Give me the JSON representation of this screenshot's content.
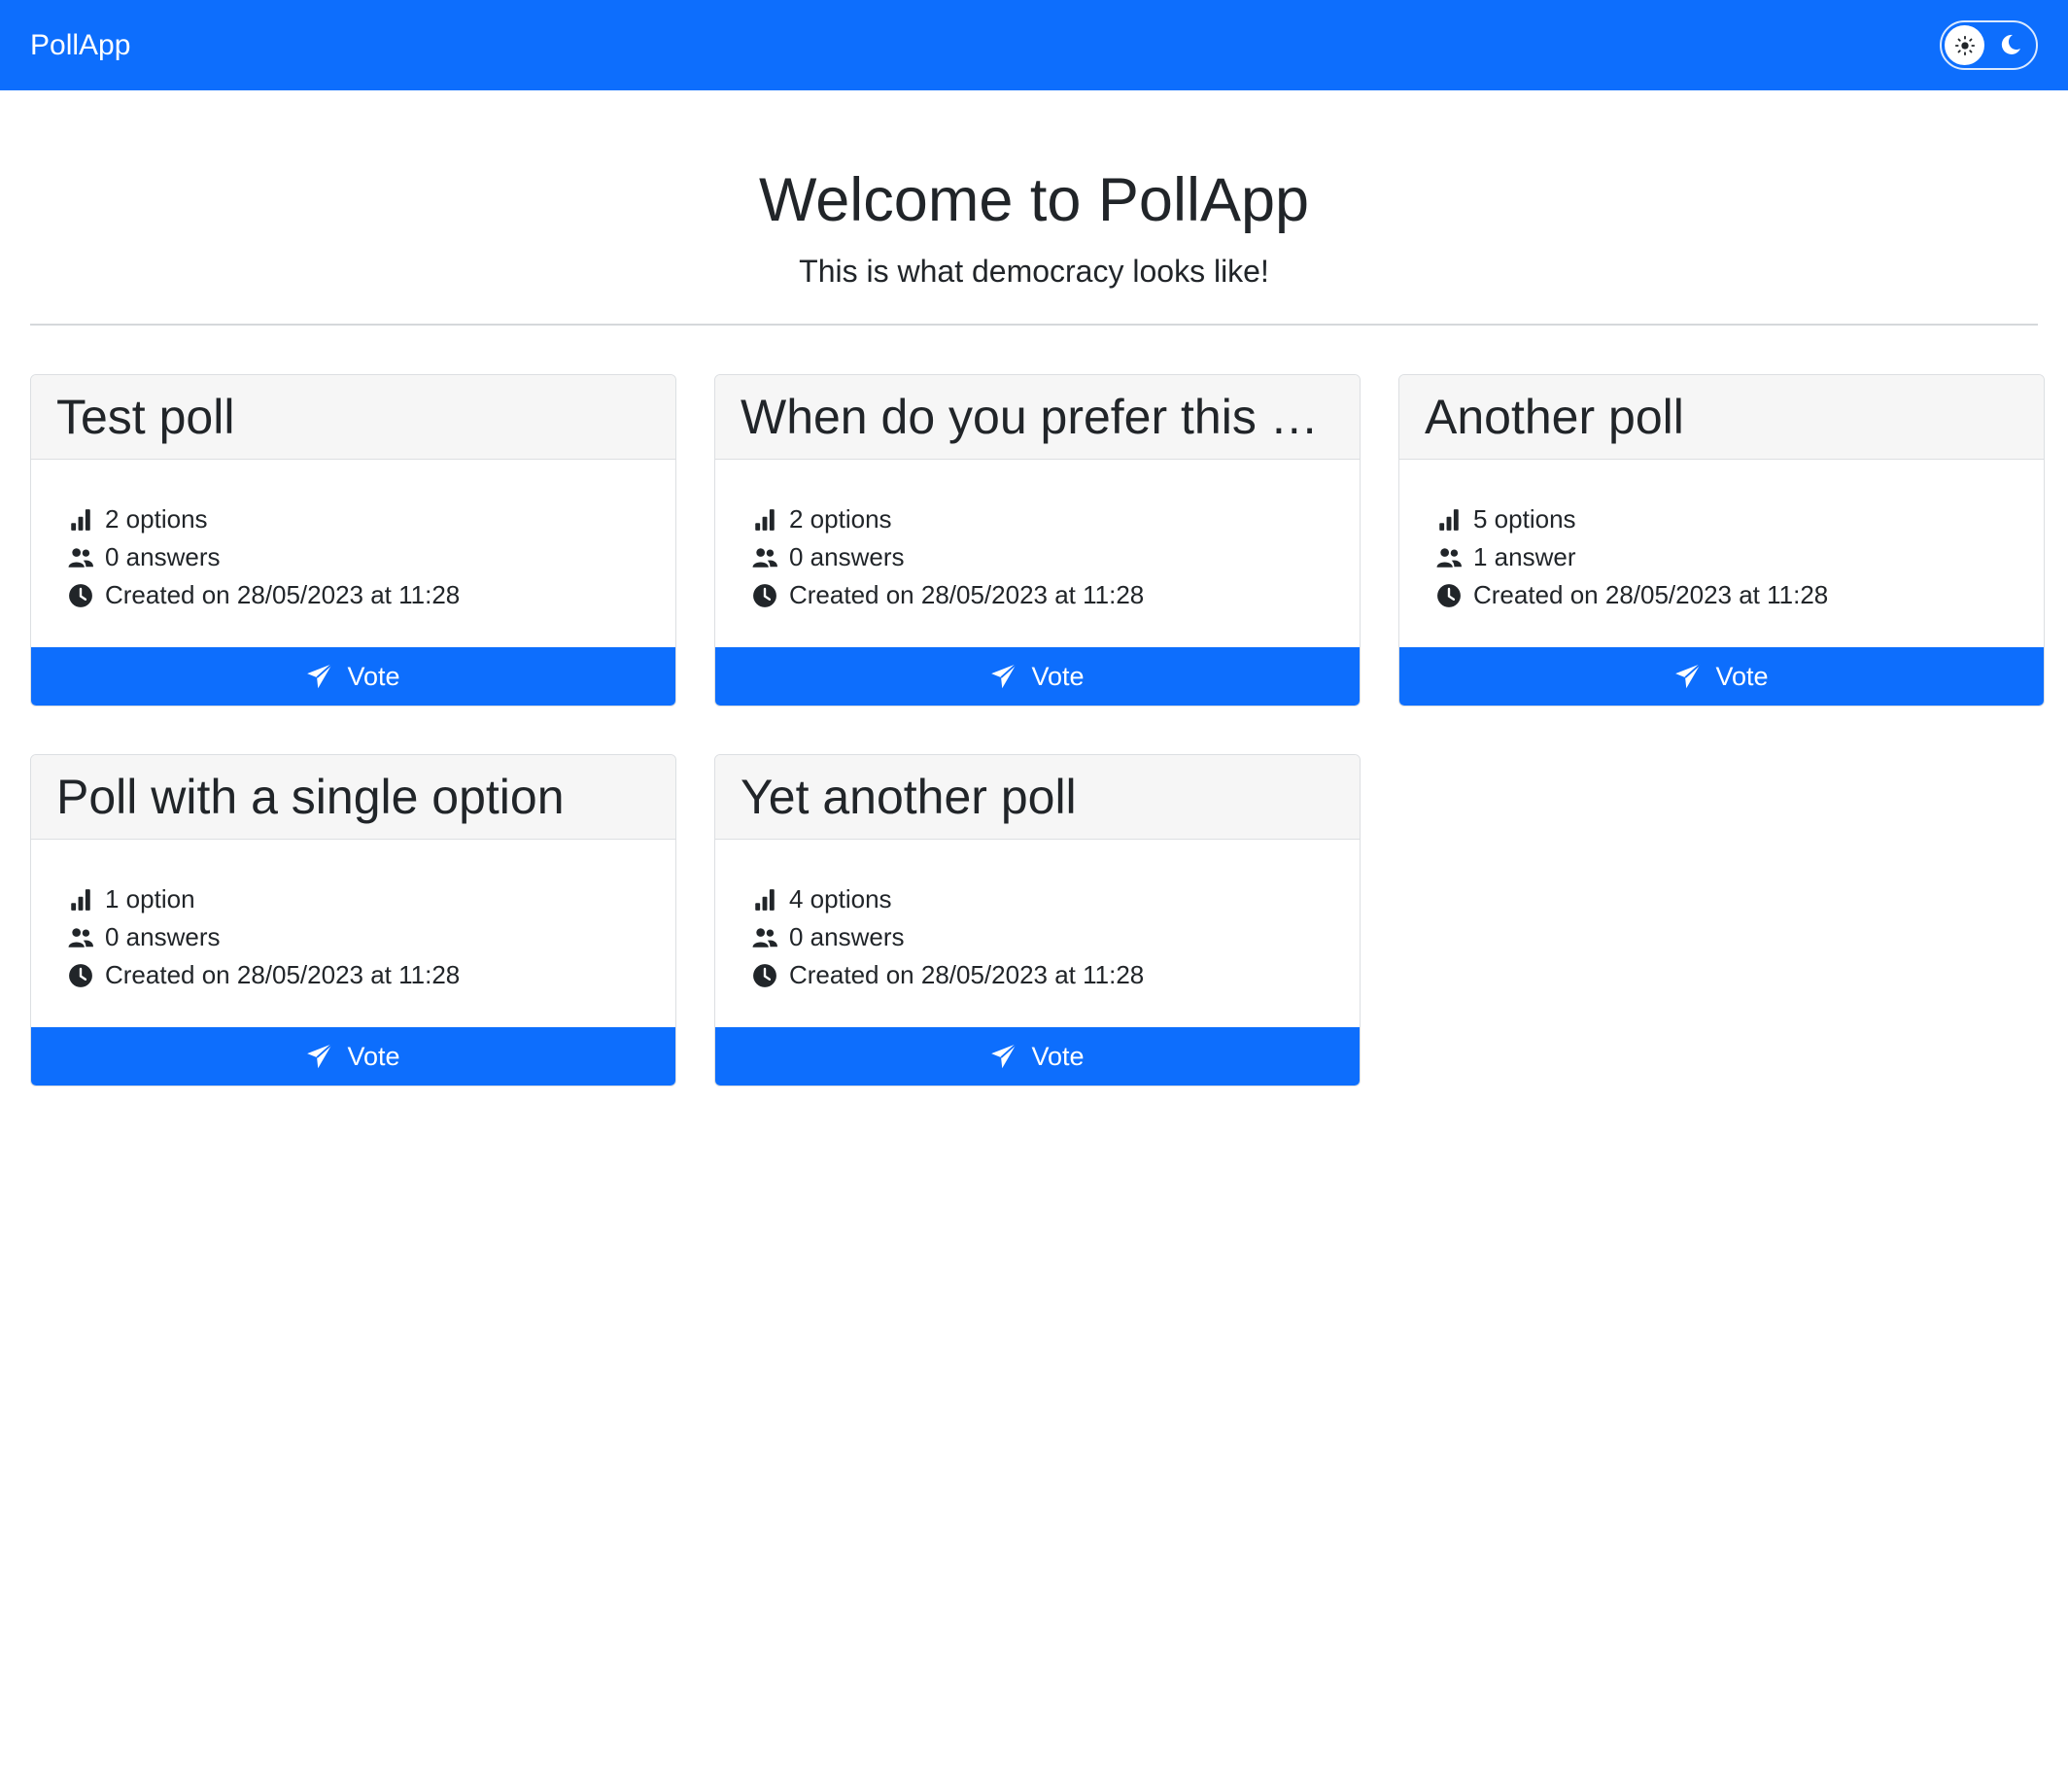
{
  "navbar": {
    "brand": "PollApp",
    "theme_toggle": {
      "light_icon": "sun-icon",
      "dark_icon": "moon-icon",
      "selected": "light"
    }
  },
  "hero": {
    "title": "Welcome to PollApp",
    "subtitle": "This is what democracy looks like!"
  },
  "colors": {
    "primary": "#0d6efd",
    "card_header_bg": "#f6f6f6",
    "text": "#212529"
  },
  "polls": [
    {
      "title": "Test poll",
      "options": "2 options",
      "answers": "0 answers",
      "created": "Created on 28/05/2023 at 11:28",
      "vote_label": "Vote"
    },
    {
      "title": "When do you prefer this c...",
      "options": "2 options",
      "answers": "0 answers",
      "created": "Created on 28/05/2023 at 11:28",
      "vote_label": "Vote"
    },
    {
      "title": "Another poll",
      "options": "5 options",
      "answers": "1 answer",
      "created": "Created on 28/05/2023 at 11:28",
      "vote_label": "Vote"
    },
    {
      "title": "Poll with a single option",
      "options": "1 option",
      "answers": "0 answers",
      "created": "Created on 28/05/2023 at 11:28",
      "vote_label": "Vote"
    },
    {
      "title": "Yet another poll",
      "options": "4 options",
      "answers": "0 answers",
      "created": "Created on 28/05/2023 at 11:28",
      "vote_label": "Vote"
    }
  ],
  "icons": {
    "options": "bar-chart-icon",
    "answers": "people-icon",
    "created": "clock-icon",
    "vote": "send-icon"
  }
}
